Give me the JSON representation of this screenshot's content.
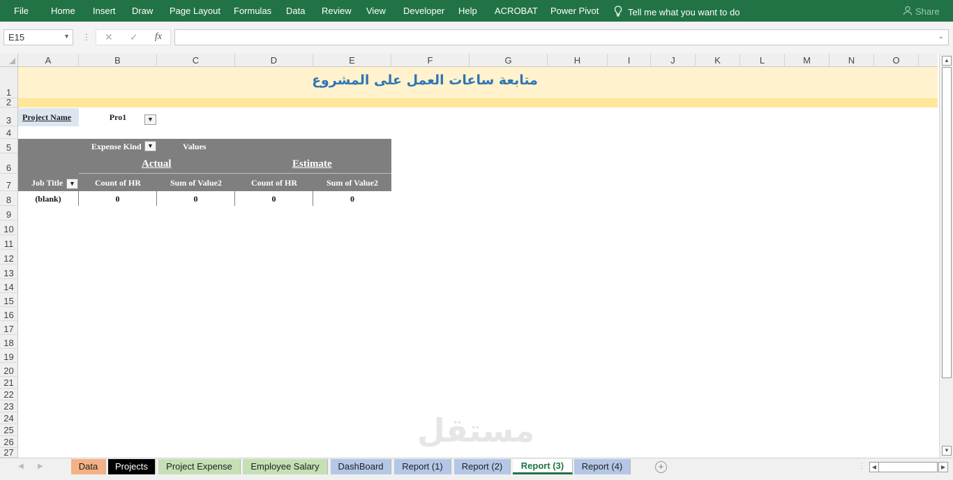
{
  "ribbon": {
    "tabs": [
      "File",
      "Home",
      "Insert",
      "Draw",
      "Page Layout",
      "Formulas",
      "Data",
      "Review",
      "View",
      "Developer",
      "Help",
      "ACROBAT",
      "Power Pivot"
    ],
    "tell_me": "Tell me what you want to do",
    "share": "Share",
    "background": "#217346"
  },
  "formula_bar": {
    "name_box": "E15",
    "cancel_icon": "✕",
    "enter_icon": "✓",
    "fx_icon": "fx",
    "formula": ""
  },
  "columns": [
    "A",
    "B",
    "C",
    "D",
    "E",
    "F",
    "G",
    "H",
    "I",
    "J",
    "K",
    "L",
    "M",
    "N",
    "O"
  ],
  "rows": [
    "1",
    "2",
    "3",
    "4",
    "5",
    "6",
    "7",
    "8",
    "9",
    "10",
    "11",
    "12",
    "13",
    "14",
    "15",
    "16",
    "17",
    "18",
    "19",
    "20",
    "21",
    "22",
    "23",
    "24",
    "25",
    "26",
    "27"
  ],
  "sheet": {
    "title": "متابعة ساعات العمل على المشروع",
    "project_name_label": "Project Name",
    "project_name_value": "Pro1",
    "pivot": {
      "expense_kind": "Expense Kind",
      "values": "Values",
      "actual": "Actual",
      "estimate": "Estimate",
      "job_title": "Job Title",
      "col_headers": [
        "Count of HR",
        "Sum of Value2",
        "Count of HR",
        "Sum of Value2"
      ],
      "row_label": "(blank)",
      "row_values": [
        "0",
        "0",
        "0",
        "0"
      ]
    },
    "watermark": "مستقل"
  },
  "sheet_tabs": [
    {
      "label": "Data",
      "color": "#f4b183"
    },
    {
      "label": "Projects",
      "color": "#000000"
    },
    {
      "label": "Project Expense",
      "color": "#c5e0b4"
    },
    {
      "label": "Employee Salary",
      "color": "#c5e0b4"
    },
    {
      "label": "DashBoard",
      "color": "#b4c7e7"
    },
    {
      "label": "Report (1)",
      "color": "#b4c7e7"
    },
    {
      "label": "Report (2)",
      "color": "#b4c7e7"
    },
    {
      "label": "Report (3)",
      "color": "#ffffff",
      "active": true
    },
    {
      "label": "Report (4)",
      "color": "#b4c7e7"
    }
  ]
}
